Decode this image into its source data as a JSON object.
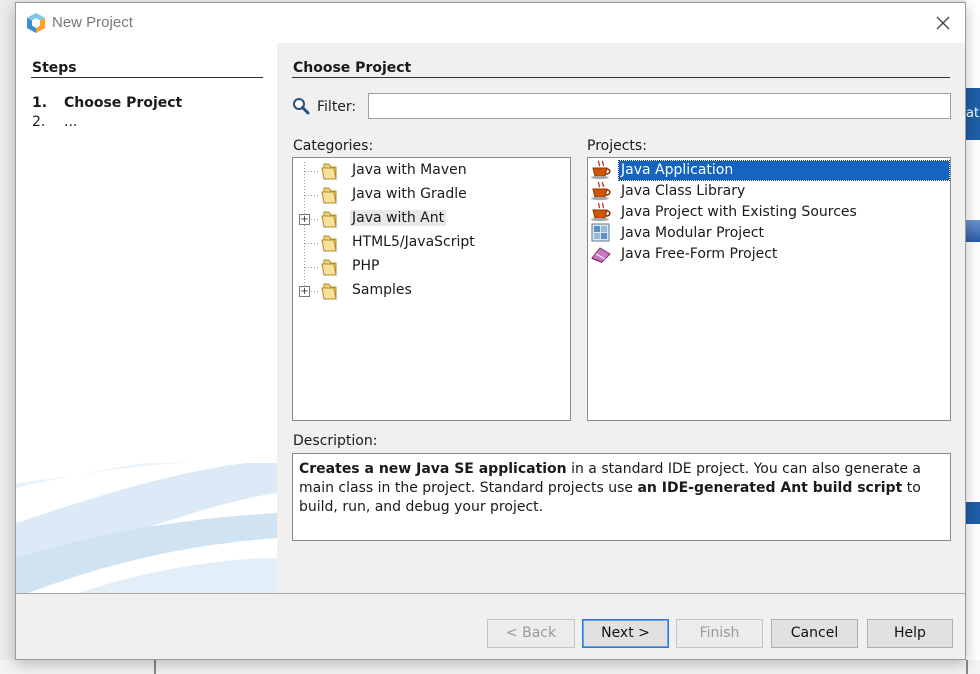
{
  "window": {
    "title": "New Project"
  },
  "steps": {
    "title": "Steps",
    "items": [
      {
        "num": "1.",
        "label": "Choose Project"
      },
      {
        "num": "2.",
        "label": "..."
      }
    ]
  },
  "content": {
    "title": "Choose Project",
    "filter": {
      "label": "Filter:",
      "value": ""
    },
    "categories": {
      "label": "Categories:",
      "items": [
        {
          "label": "Java with Maven",
          "expandable": false
        },
        {
          "label": "Java with Gradle",
          "expandable": false
        },
        {
          "label": "Java with Ant",
          "expandable": true,
          "selected": true
        },
        {
          "label": "HTML5/JavaScript",
          "expandable": false
        },
        {
          "label": "PHP",
          "expandable": false
        },
        {
          "label": "Samples",
          "expandable": true
        }
      ]
    },
    "projects": {
      "label": "Projects:",
      "items": [
        {
          "label": "Java Application",
          "icon": "java-cup-icon",
          "selected": true
        },
        {
          "label": "Java Class Library",
          "icon": "java-cup-icon"
        },
        {
          "label": "Java Project with Existing Sources",
          "icon": "java-cup-icon"
        },
        {
          "label": "Java Modular Project",
          "icon": "modules-icon"
        },
        {
          "label": "Java Free-Form Project",
          "icon": "freeform-icon"
        }
      ]
    },
    "description": {
      "label": "Description:",
      "parts": [
        {
          "text": "Creates a new Java SE application",
          "bold": true
        },
        {
          "text": " in a standard IDE project. You can also generate a main class in the project. Standard projects use ",
          "bold": false
        },
        {
          "text": "an IDE-generated Ant build script",
          "bold": true
        },
        {
          "text": " to build, run, and debug your project.",
          "bold": false
        }
      ]
    }
  },
  "buttons": {
    "back": "< Back",
    "next": "Next >",
    "finish": "Finish",
    "cancel": "Cancel",
    "help": "Help"
  },
  "background": {
    "right_fragment_text": "at'"
  },
  "colors": {
    "selection": "#1565c0",
    "default_button_border": "#2b78d6"
  }
}
